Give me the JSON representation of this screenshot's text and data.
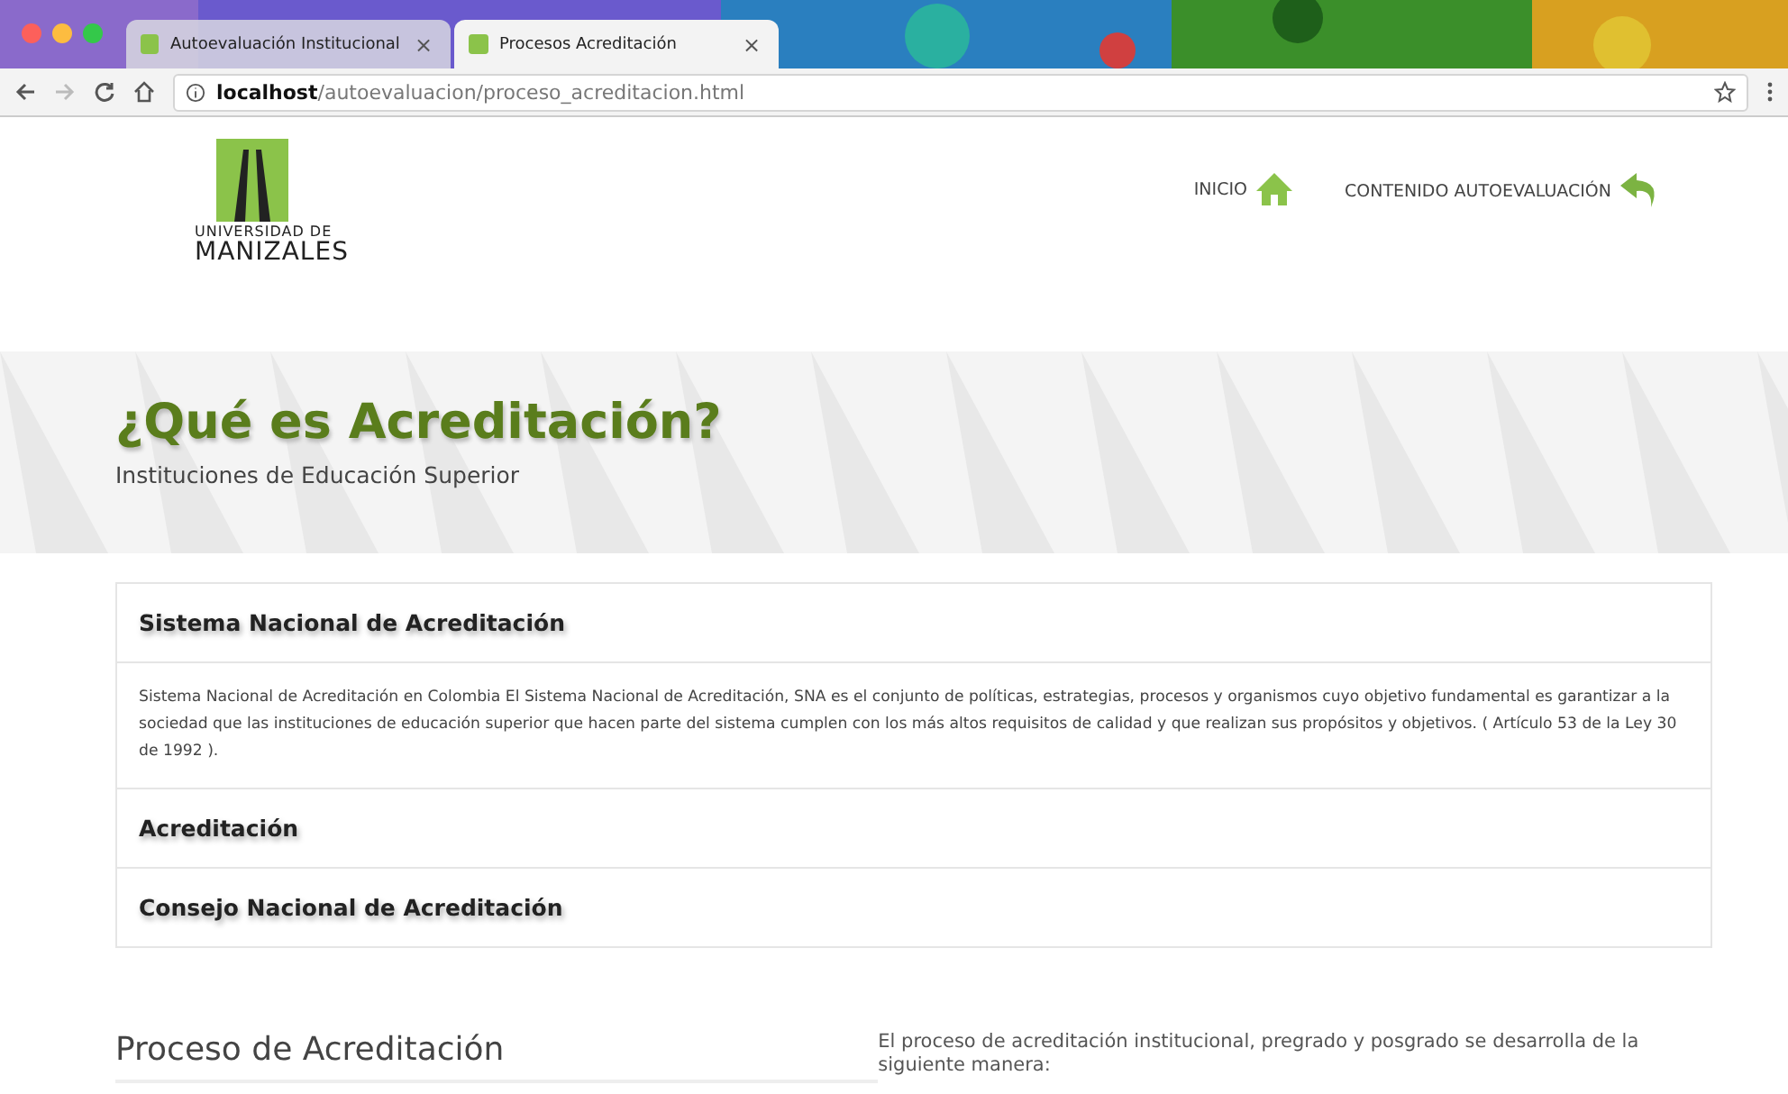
{
  "browser": {
    "tabs": [
      {
        "title": "Autoevaluación Institucional",
        "close": "×",
        "selected": false
      },
      {
        "title": "Procesos Acreditación",
        "close": "×",
        "selected": true
      }
    ],
    "url_host": "localhost",
    "url_path": "/autoevaluacion/proceso_acreditacion.html"
  },
  "header": {
    "logo_line_1": "UNIVERSIDAD DE",
    "logo_line_2": "MANIZALES",
    "nav": [
      {
        "label": "INICIO",
        "kind": "home"
      },
      {
        "label": "CONTENIDO AUTOEVALUACIÓN",
        "kind": "back"
      }
    ]
  },
  "hero": {
    "title": "¿Qué es Acreditación?",
    "subtitle": "Instituciones de Educación Superior"
  },
  "accordion": [
    {
      "title": "Sistema Nacional de Acreditación",
      "body": "Sistema Nacional de Acreditación en Colombia El Sistema Nacional de Acreditación, SNA es el conjunto de políticas, estrategias, procesos y organismos cuyo objetivo fundamental es garantizar a la sociedad que las instituciones de educación superior que hacen parte del sistema cumplen con los más altos requisitos de calidad y que realizan sus propósitos y objetivos. ( Artículo 53 de la Ley 30 de 1992 )."
    },
    {
      "title": "Acreditación"
    },
    {
      "title": "Consejo Nacional de Acreditación"
    }
  ],
  "process": {
    "title": "Proceso de Acreditación",
    "intro": "El proceso de acreditación institucional, pregrado y posgrado se desarrolla de la siguiente manera:"
  }
}
